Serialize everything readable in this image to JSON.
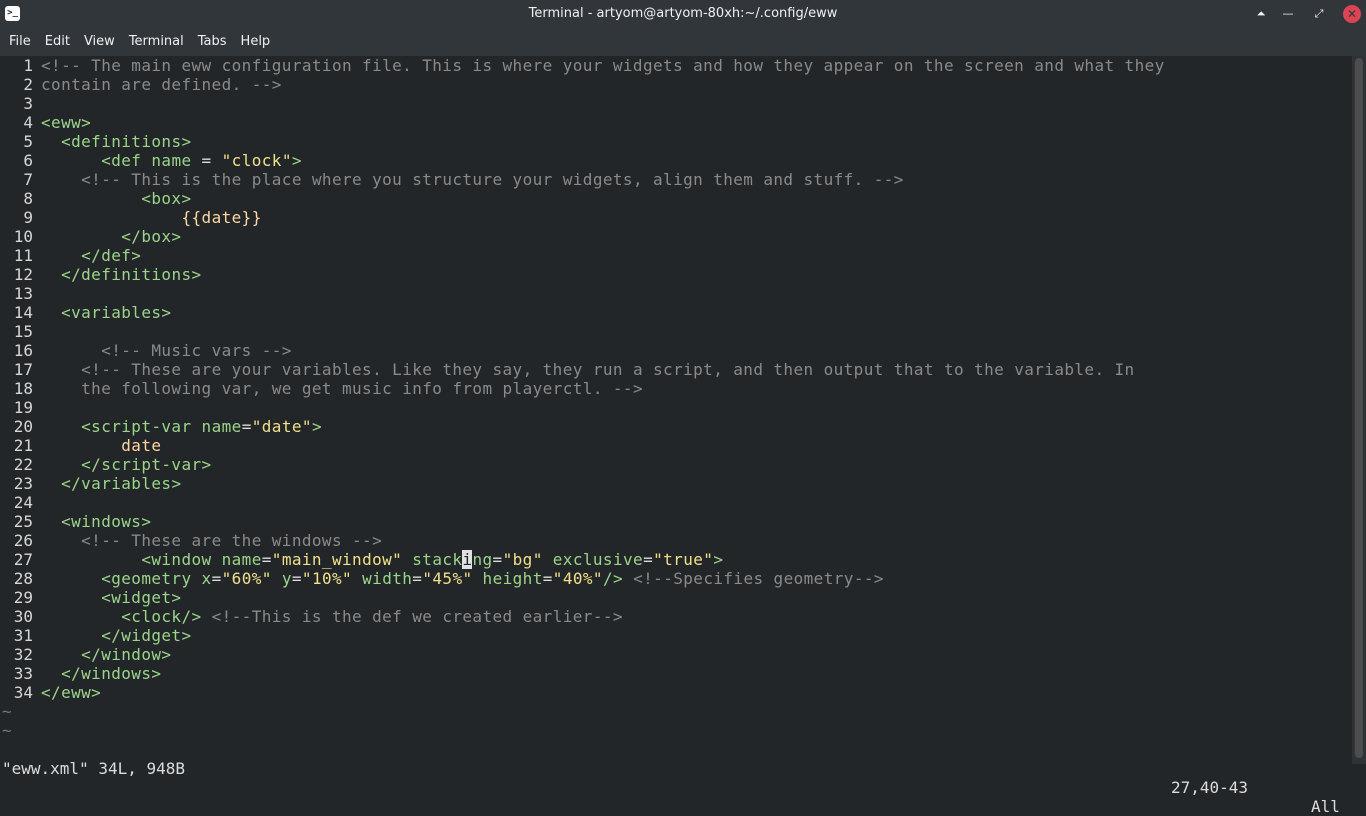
{
  "window": {
    "title": "Terminal - artyom@artyom-80xh:~/.config/eww",
    "app_icon": "terminal-icon",
    "controls": {
      "keep_above": "keep-above-icon",
      "minimize": "minimize-icon",
      "maximize": "restore-icon",
      "close": "close-icon"
    }
  },
  "menu": [
    "File",
    "Edit",
    "View",
    "Terminal",
    "Tabs",
    "Help"
  ],
  "editor": {
    "lines": [
      {
        "n": "1",
        "segs": [
          {
            "c": "cm",
            "t": "<!-- The main eww configuration file. This is where your widgets and how they appear on the screen and what they"
          }
        ]
      },
      {
        "n": "2",
        "segs": [
          {
            "c": "cm",
            "t": "contain are defined. -->"
          }
        ]
      },
      {
        "n": "3",
        "segs": []
      },
      {
        "n": "4",
        "segs": [
          {
            "c": "tag",
            "t": "<eww>"
          }
        ]
      },
      {
        "n": "5",
        "segs": [
          {
            "c": "pl",
            "t": "  "
          },
          {
            "c": "tag",
            "t": "<definitions>"
          }
        ]
      },
      {
        "n": "6",
        "segs": [
          {
            "c": "pl",
            "t": "      "
          },
          {
            "c": "tag",
            "t": "<def"
          },
          {
            "c": "at",
            "t": " name "
          },
          {
            "c": "pl",
            "t": "= "
          },
          {
            "c": "str",
            "t": "\"clock\""
          },
          {
            "c": "tag",
            "t": ">"
          }
        ]
      },
      {
        "n": "7",
        "segs": [
          {
            "c": "pl",
            "t": "    "
          },
          {
            "c": "cm",
            "t": "<!-- This is the place where you structure your widgets, align them and stuff. -->"
          }
        ]
      },
      {
        "n": "8",
        "segs": [
          {
            "c": "pl",
            "t": "          "
          },
          {
            "c": "tag",
            "t": "<box>"
          }
        ]
      },
      {
        "n": "9",
        "segs": [
          {
            "c": "pl",
            "t": "              "
          },
          {
            "c": "tx",
            "t": "{{date}}"
          }
        ]
      },
      {
        "n": "10",
        "segs": [
          {
            "c": "pl",
            "t": "        "
          },
          {
            "c": "tag",
            "t": "</box>"
          }
        ]
      },
      {
        "n": "11",
        "segs": [
          {
            "c": "pl",
            "t": "    "
          },
          {
            "c": "tag",
            "t": "</def>"
          }
        ]
      },
      {
        "n": "12",
        "segs": [
          {
            "c": "pl",
            "t": "  "
          },
          {
            "c": "tag",
            "t": "</definitions>"
          }
        ]
      },
      {
        "n": "13",
        "segs": []
      },
      {
        "n": "14",
        "segs": [
          {
            "c": "pl",
            "t": "  "
          },
          {
            "c": "tag",
            "t": "<variables>"
          }
        ]
      },
      {
        "n": "15",
        "segs": []
      },
      {
        "n": "16",
        "segs": [
          {
            "c": "pl",
            "t": "      "
          },
          {
            "c": "cm",
            "t": "<!-- Music vars -->"
          }
        ]
      },
      {
        "n": "17",
        "segs": [
          {
            "c": "pl",
            "t": "    "
          },
          {
            "c": "cm",
            "t": "<!-- These are your variables. Like they say, they run a script, and then output that to the variable. In"
          }
        ]
      },
      {
        "n": "18",
        "segs": [
          {
            "c": "pl",
            "t": "    "
          },
          {
            "c": "cm",
            "t": "the following var, we get music info from playerctl. -->"
          }
        ]
      },
      {
        "n": "19",
        "segs": []
      },
      {
        "n": "20",
        "segs": [
          {
            "c": "pl",
            "t": "    "
          },
          {
            "c": "tag",
            "t": "<script-var"
          },
          {
            "c": "at",
            "t": " name"
          },
          {
            "c": "pl",
            "t": "="
          },
          {
            "c": "str",
            "t": "\"date\""
          },
          {
            "c": "tag",
            "t": ">"
          }
        ]
      },
      {
        "n": "21",
        "segs": [
          {
            "c": "pl",
            "t": "        "
          },
          {
            "c": "tx",
            "t": "date"
          }
        ]
      },
      {
        "n": "22",
        "segs": [
          {
            "c": "pl",
            "t": "    "
          },
          {
            "c": "tag",
            "t": "</script-var>"
          }
        ]
      },
      {
        "n": "23",
        "segs": [
          {
            "c": "pl",
            "t": "  "
          },
          {
            "c": "tag",
            "t": "</variables>"
          }
        ]
      },
      {
        "n": "24",
        "segs": []
      },
      {
        "n": "25",
        "segs": [
          {
            "c": "pl",
            "t": "  "
          },
          {
            "c": "tag",
            "t": "<windows>"
          }
        ]
      },
      {
        "n": "26",
        "segs": [
          {
            "c": "pl",
            "t": "    "
          },
          {
            "c": "cm",
            "t": "<!-- These are the windows -->"
          }
        ]
      },
      {
        "n": "27",
        "segs": [
          {
            "c": "pl",
            "t": "          "
          },
          {
            "c": "tag",
            "t": "<window"
          },
          {
            "c": "at",
            "t": " name"
          },
          {
            "c": "pl",
            "t": "="
          },
          {
            "c": "str",
            "t": "\"main_window\""
          },
          {
            "c": "at",
            "t": " stack"
          },
          {
            "c": "cur",
            "t": "i"
          },
          {
            "c": "at",
            "t": "ng"
          },
          {
            "c": "pl",
            "t": "="
          },
          {
            "c": "str",
            "t": "\"bg\""
          },
          {
            "c": "at",
            "t": " exclusive"
          },
          {
            "c": "pl",
            "t": "="
          },
          {
            "c": "str",
            "t": "\"true\""
          },
          {
            "c": "tag",
            "t": ">"
          }
        ]
      },
      {
        "n": "28",
        "segs": [
          {
            "c": "pl",
            "t": "      "
          },
          {
            "c": "tag",
            "t": "<geometry"
          },
          {
            "c": "at",
            "t": " x"
          },
          {
            "c": "pl",
            "t": "="
          },
          {
            "c": "str",
            "t": "\"60%\""
          },
          {
            "c": "at",
            "t": " y"
          },
          {
            "c": "pl",
            "t": "="
          },
          {
            "c": "str",
            "t": "\"10%\""
          },
          {
            "c": "at",
            "t": " width"
          },
          {
            "c": "pl",
            "t": "="
          },
          {
            "c": "str",
            "t": "\"45%\""
          },
          {
            "c": "at",
            "t": " height"
          },
          {
            "c": "pl",
            "t": "="
          },
          {
            "c": "str",
            "t": "\"40%\""
          },
          {
            "c": "tag",
            "t": "/>"
          },
          {
            "c": "pl",
            "t": " "
          },
          {
            "c": "cm",
            "t": "<!--Specifies geometry-->"
          }
        ]
      },
      {
        "n": "29",
        "segs": [
          {
            "c": "pl",
            "t": "      "
          },
          {
            "c": "tag",
            "t": "<widget>"
          }
        ]
      },
      {
        "n": "30",
        "segs": [
          {
            "c": "pl",
            "t": "        "
          },
          {
            "c": "tag",
            "t": "<clock/>"
          },
          {
            "c": "pl",
            "t": " "
          },
          {
            "c": "cm",
            "t": "<!--This is the def we created earlier-->"
          }
        ]
      },
      {
        "n": "31",
        "segs": [
          {
            "c": "pl",
            "t": "      "
          },
          {
            "c": "tag",
            "t": "</widget>"
          }
        ]
      },
      {
        "n": "32",
        "segs": [
          {
            "c": "pl",
            "t": "    "
          },
          {
            "c": "tag",
            "t": "</window>"
          }
        ]
      },
      {
        "n": "33",
        "segs": [
          {
            "c": "pl",
            "t": "  "
          },
          {
            "c": "tag",
            "t": "</windows>"
          }
        ]
      },
      {
        "n": "34",
        "segs": [
          {
            "c": "tag",
            "t": "</eww>"
          }
        ]
      }
    ],
    "tildes": [
      "~",
      "~"
    ]
  },
  "status": {
    "file_info": "\"eww.xml\" 34L, 948B",
    "cursor_pos": "27,40-43",
    "scroll_pct": "All"
  },
  "colors": {
    "background": "#232629",
    "titlebar": "#31363b",
    "close_button": "#da4453",
    "comment": "#8a8a8a",
    "tag": "#9bd58a",
    "string": "#f0e08a",
    "text": "#ffd7a0"
  }
}
